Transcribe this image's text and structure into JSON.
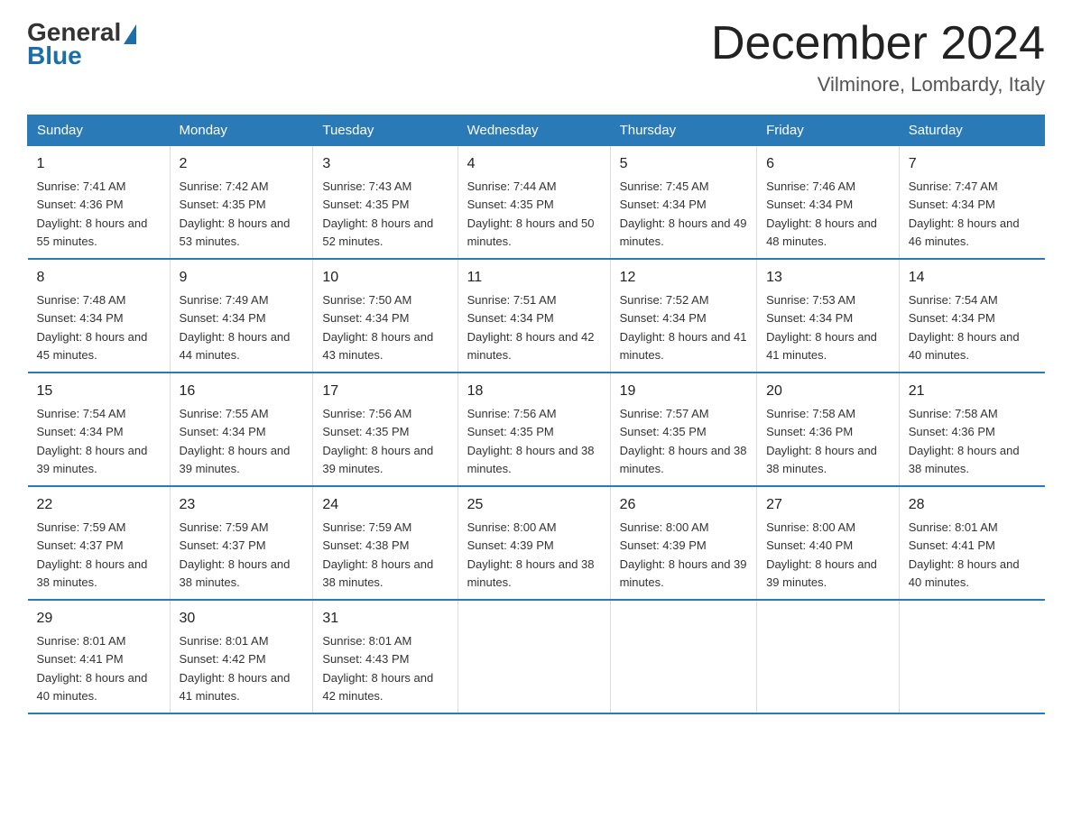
{
  "logo": {
    "general": "General",
    "blue": "Blue"
  },
  "title": "December 2024",
  "location": "Vilminore, Lombardy, Italy",
  "days_of_week": [
    "Sunday",
    "Monday",
    "Tuesday",
    "Wednesday",
    "Thursday",
    "Friday",
    "Saturday"
  ],
  "weeks": [
    [
      {
        "day": "1",
        "sunrise": "7:41 AM",
        "sunset": "4:36 PM",
        "daylight": "8 hours and 55 minutes."
      },
      {
        "day": "2",
        "sunrise": "7:42 AM",
        "sunset": "4:35 PM",
        "daylight": "8 hours and 53 minutes."
      },
      {
        "day": "3",
        "sunrise": "7:43 AM",
        "sunset": "4:35 PM",
        "daylight": "8 hours and 52 minutes."
      },
      {
        "day": "4",
        "sunrise": "7:44 AM",
        "sunset": "4:35 PM",
        "daylight": "8 hours and 50 minutes."
      },
      {
        "day": "5",
        "sunrise": "7:45 AM",
        "sunset": "4:34 PM",
        "daylight": "8 hours and 49 minutes."
      },
      {
        "day": "6",
        "sunrise": "7:46 AM",
        "sunset": "4:34 PM",
        "daylight": "8 hours and 48 minutes."
      },
      {
        "day": "7",
        "sunrise": "7:47 AM",
        "sunset": "4:34 PM",
        "daylight": "8 hours and 46 minutes."
      }
    ],
    [
      {
        "day": "8",
        "sunrise": "7:48 AM",
        "sunset": "4:34 PM",
        "daylight": "8 hours and 45 minutes."
      },
      {
        "day": "9",
        "sunrise": "7:49 AM",
        "sunset": "4:34 PM",
        "daylight": "8 hours and 44 minutes."
      },
      {
        "day": "10",
        "sunrise": "7:50 AM",
        "sunset": "4:34 PM",
        "daylight": "8 hours and 43 minutes."
      },
      {
        "day": "11",
        "sunrise": "7:51 AM",
        "sunset": "4:34 PM",
        "daylight": "8 hours and 42 minutes."
      },
      {
        "day": "12",
        "sunrise": "7:52 AM",
        "sunset": "4:34 PM",
        "daylight": "8 hours and 41 minutes."
      },
      {
        "day": "13",
        "sunrise": "7:53 AM",
        "sunset": "4:34 PM",
        "daylight": "8 hours and 41 minutes."
      },
      {
        "day": "14",
        "sunrise": "7:54 AM",
        "sunset": "4:34 PM",
        "daylight": "8 hours and 40 minutes."
      }
    ],
    [
      {
        "day": "15",
        "sunrise": "7:54 AM",
        "sunset": "4:34 PM",
        "daylight": "8 hours and 39 minutes."
      },
      {
        "day": "16",
        "sunrise": "7:55 AM",
        "sunset": "4:34 PM",
        "daylight": "8 hours and 39 minutes."
      },
      {
        "day": "17",
        "sunrise": "7:56 AM",
        "sunset": "4:35 PM",
        "daylight": "8 hours and 39 minutes."
      },
      {
        "day": "18",
        "sunrise": "7:56 AM",
        "sunset": "4:35 PM",
        "daylight": "8 hours and 38 minutes."
      },
      {
        "day": "19",
        "sunrise": "7:57 AM",
        "sunset": "4:35 PM",
        "daylight": "8 hours and 38 minutes."
      },
      {
        "day": "20",
        "sunrise": "7:58 AM",
        "sunset": "4:36 PM",
        "daylight": "8 hours and 38 minutes."
      },
      {
        "day": "21",
        "sunrise": "7:58 AM",
        "sunset": "4:36 PM",
        "daylight": "8 hours and 38 minutes."
      }
    ],
    [
      {
        "day": "22",
        "sunrise": "7:59 AM",
        "sunset": "4:37 PM",
        "daylight": "8 hours and 38 minutes."
      },
      {
        "day": "23",
        "sunrise": "7:59 AM",
        "sunset": "4:37 PM",
        "daylight": "8 hours and 38 minutes."
      },
      {
        "day": "24",
        "sunrise": "7:59 AM",
        "sunset": "4:38 PM",
        "daylight": "8 hours and 38 minutes."
      },
      {
        "day": "25",
        "sunrise": "8:00 AM",
        "sunset": "4:39 PM",
        "daylight": "8 hours and 38 minutes."
      },
      {
        "day": "26",
        "sunrise": "8:00 AM",
        "sunset": "4:39 PM",
        "daylight": "8 hours and 39 minutes."
      },
      {
        "day": "27",
        "sunrise": "8:00 AM",
        "sunset": "4:40 PM",
        "daylight": "8 hours and 39 minutes."
      },
      {
        "day": "28",
        "sunrise": "8:01 AM",
        "sunset": "4:41 PM",
        "daylight": "8 hours and 40 minutes."
      }
    ],
    [
      {
        "day": "29",
        "sunrise": "8:01 AM",
        "sunset": "4:41 PM",
        "daylight": "8 hours and 40 minutes."
      },
      {
        "day": "30",
        "sunrise": "8:01 AM",
        "sunset": "4:42 PM",
        "daylight": "8 hours and 41 minutes."
      },
      {
        "day": "31",
        "sunrise": "8:01 AM",
        "sunset": "4:43 PM",
        "daylight": "8 hours and 42 minutes."
      },
      null,
      null,
      null,
      null
    ]
  ],
  "labels": {
    "sunrise_prefix": "Sunrise: ",
    "sunset_prefix": "Sunset: ",
    "daylight_prefix": "Daylight: "
  }
}
